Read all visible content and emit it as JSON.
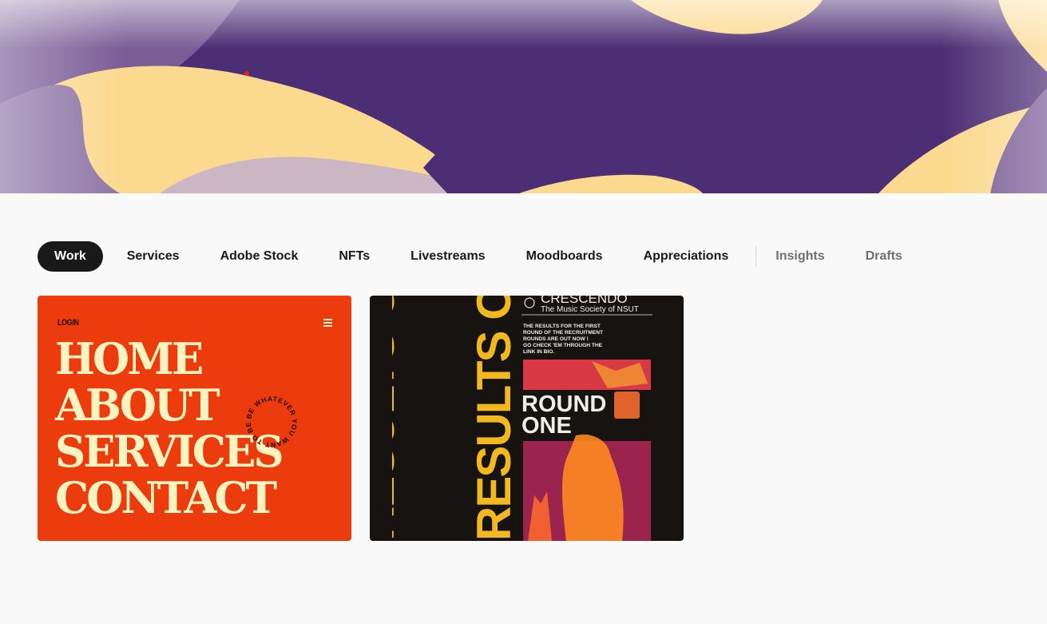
{
  "tabs": [
    {
      "label": "Work",
      "active": true
    },
    {
      "label": "Services"
    },
    {
      "label": "Adobe Stock"
    },
    {
      "label": "NFTs"
    },
    {
      "label": "Livestreams"
    },
    {
      "label": "Moodboards"
    },
    {
      "label": "Appreciations"
    }
  ],
  "tabs_secondary": [
    {
      "label": "Insights"
    },
    {
      "label": "Drafts"
    }
  ],
  "projects": [
    {
      "login": "LOGIN",
      "menu_icon": "hamburger-icon",
      "nav": [
        "HOME",
        "ABOUT",
        "SERVICES",
        "CONTACT"
      ],
      "ring_text": "BE WHATEVER YOU WANT TO BE"
    },
    {
      "side_text": "RESULTS OUT",
      "brand": "CRESCENDO",
      "subtitle": "The Music Society of NSUT",
      "body": [
        "THE RESULTS FOR THE FIRST",
        "ROUND OF THE RECRUITMENT",
        "ROUNDS ARE OUT NOW !",
        "GO CHECK 'EM THROUGH THE",
        "LINK IN BIO."
      ],
      "headline": [
        "ROUND",
        "ONE"
      ]
    }
  ],
  "colors": {
    "banner_purple": "#4c2e74",
    "banner_yellow": "#fbd98e",
    "card1_bg": "#ec3b0c",
    "card1_text": "#fbf3c0",
    "card2_bg": "#171311",
    "card2_yellow": "#f2b81f"
  }
}
